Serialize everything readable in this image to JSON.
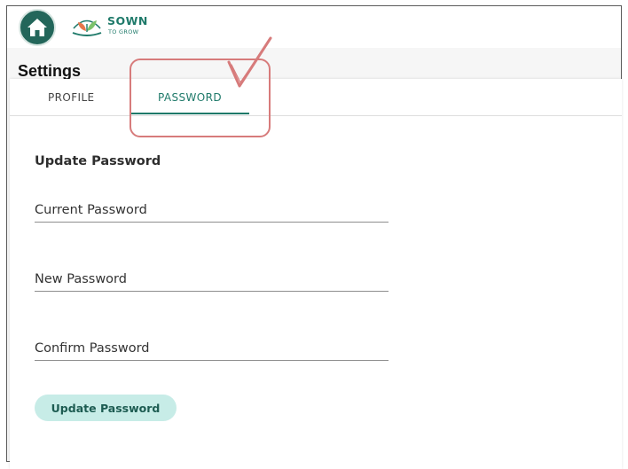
{
  "brand": {
    "title": "SOWN",
    "subtitle": "TO GROW",
    "home_icon": "home-icon",
    "accent_color": "#1f7a6a",
    "home_bg_color": "#23665a"
  },
  "page": {
    "title": "Settings"
  },
  "tabs": [
    {
      "label": "PROFILE",
      "active": false
    },
    {
      "label": "PASSWORD",
      "active": true
    }
  ],
  "form": {
    "title": "Update Password",
    "fields": [
      {
        "label": "Current Password",
        "value": ""
      },
      {
        "label": "New Password",
        "value": ""
      },
      {
        "label": "Confirm Password",
        "value": ""
      }
    ],
    "submit_label": "Update Password",
    "submit_color": "#c7ece7"
  },
  "annotation": {
    "color": "#d77b7b",
    "target": "PASSWORD"
  }
}
